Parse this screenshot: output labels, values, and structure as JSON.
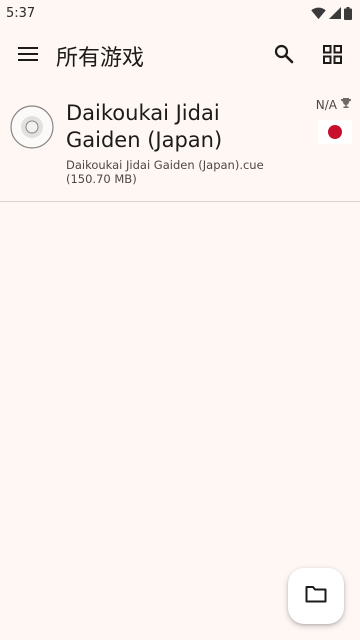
{
  "status_bar": {
    "time": "5:37"
  },
  "app_bar": {
    "title": "所有游戏",
    "icons": [
      "menu-icon",
      "search-icon",
      "grid-view-icon"
    ]
  },
  "games": [
    {
      "title": "Daikoukai Jidai Gaiden (Japan)",
      "file_name": "Daikoukai Jidai Gaiden (Japan).cue",
      "file_size": "(150.70 MB)",
      "compatibility": "N/A",
      "region": "Japan",
      "icon": "disc-icon"
    }
  ],
  "fab": {
    "icon": "folder-icon"
  },
  "colors": {
    "background": "#fef7f4",
    "flag_red": "#c8102e",
    "divider": "#d8d2cf"
  }
}
